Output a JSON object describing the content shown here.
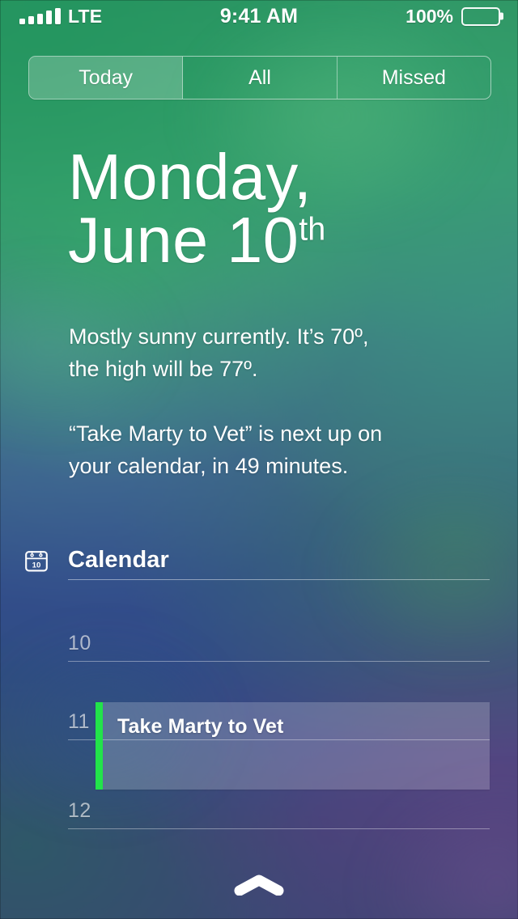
{
  "status_bar": {
    "signal_icon": "cellular-signal-icon",
    "signal_bars": 5,
    "carrier": "LTE",
    "time": "9:41 AM",
    "battery_percent": "100%",
    "battery_icon": "battery-full-icon",
    "battery_level": 100
  },
  "segmented_control": {
    "selected_index": 0,
    "segments": [
      {
        "label": "Today",
        "selected": true
      },
      {
        "label": "All",
        "selected": false
      },
      {
        "label": "Missed",
        "selected": false
      }
    ]
  },
  "date": {
    "line1": "Monday,",
    "line2": "June 10",
    "ordinal": "th"
  },
  "summary": {
    "weather": "Mostly sunny currently. It’s 70º, the high will be 77º.",
    "weather_line1": "Mostly sunny currently. It’s 70º,",
    "weather_line2": "the high will be 77º.",
    "calendar": "“Take Marty to Vet” is next up on your calendar, in 49 minutes.",
    "calendar_line1": "“Take Marty to Vet” is next up on",
    "calendar_line2": "your calendar, in 49 minutes.",
    "current_temp": "70º",
    "high_temp": "77º",
    "minutes_until_event": "49 minutes"
  },
  "calendar_widget": {
    "icon": "calendar-icon",
    "icon_day": "10",
    "title": "Calendar",
    "hours": [
      {
        "label": "10"
      },
      {
        "label": "11"
      },
      {
        "label": "12"
      }
    ],
    "event": {
      "title": "Take Marty to Vet",
      "accent_color": "#22e34a"
    }
  },
  "grabber": {
    "icon": "chevron-up-grabber-icon"
  },
  "colors": {
    "accent_event": "#22e34a",
    "text_primary": "#ffffff",
    "hour_label": "rgba(255,255,255,0.62)"
  }
}
